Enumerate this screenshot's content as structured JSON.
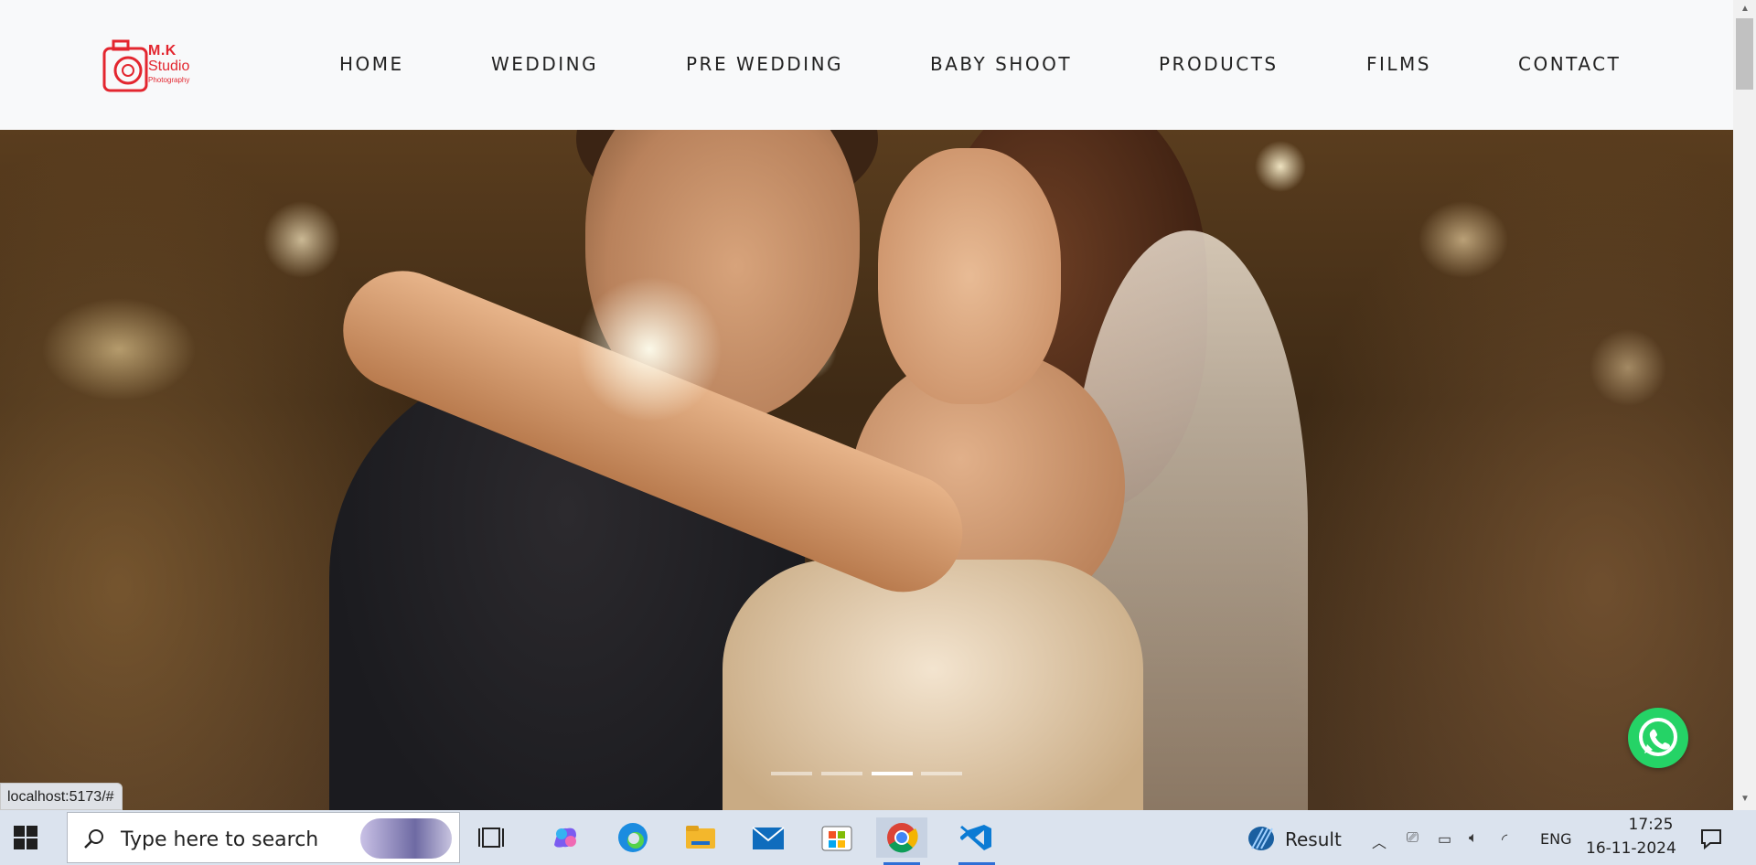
{
  "brand": {
    "line1": "M.K",
    "line2": "Studio",
    "line3": "Photography",
    "color": "#e3262f"
  },
  "nav": {
    "items": [
      {
        "label": "HOME"
      },
      {
        "label": "WEDDING"
      },
      {
        "label": "PRE WEDDING"
      },
      {
        "label": "BABY SHOOT"
      },
      {
        "label": "PRODUCTS"
      },
      {
        "label": "FILMS"
      },
      {
        "label": "CONTACT"
      }
    ]
  },
  "carousel": {
    "image": "wedding-couple-dancing-photo",
    "slide_count": 4,
    "active_index": 2
  },
  "whatsapp": {
    "icon": "whatsapp-icon",
    "color": "#25d366"
  },
  "status_bar": {
    "url": "localhost:5173/#"
  },
  "taskbar": {
    "search_placeholder": "Type here to search",
    "apps": [
      "task-view-icon",
      "copilot-icon",
      "edge-icon",
      "file-explorer-icon",
      "mail-icon",
      "store-icon",
      "chrome-icon",
      "vscode-icon"
    ],
    "active_app": "vscode-icon",
    "widget_label": "Result",
    "language": "ENG",
    "time": "17:25",
    "date": "16-11-2024"
  }
}
